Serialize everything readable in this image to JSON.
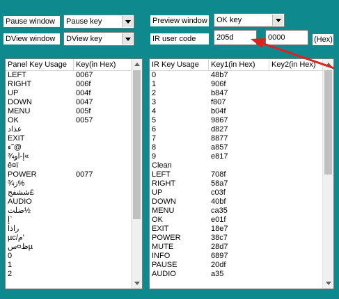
{
  "top": {
    "pause_window_label": "Pause window",
    "pause_key_value": "Pause key",
    "preview_window_label": "Preview window",
    "ok_key_value": "OK key",
    "dview_window_label": "DView window",
    "dview_key_value": "DView key",
    "ir_user_code_label": "IR user code",
    "ir_user_code_value": "205d",
    "second_code_value": "0000",
    "hex_label": "(Hex)"
  },
  "panel_table": {
    "headers": [
      "Panel Key Usage",
      "Key(in Hex)"
    ],
    "rows": [
      [
        "LEFT",
        "0067"
      ],
      [
        "RIGHT",
        "006f"
      ],
      [
        "UP",
        "004f"
      ],
      [
        "DOWN",
        "0047"
      ],
      [
        "MENU",
        "005f"
      ],
      [
        "OK",
        "0057"
      ],
      [
        "عذاد",
        ""
      ],
      [
        "EXIT",
        ""
      ],
      [
        "ء˜@",
        ""
      ],
      [
        "¾إ-أو«",
        ""
      ],
      [
        "ê¤ï",
        ""
      ],
      [
        "POWER",
        "0077"
      ],
      [
        "¾ز%",
        ""
      ],
      [
        "ششفج£",
        ""
      ],
      [
        "AUDIO",
        ""
      ],
      [
        "ضلت½",
        ""
      ],
      [
        "إ`",
        ""
      ],
      [
        "راذا",
        ""
      ],
      [
        "µc/م'",
        ""
      ],
      [
        "ظ¤سµ",
        ""
      ],
      [
        "0",
        ""
      ],
      [
        "1",
        ""
      ],
      [
        "2",
        ""
      ]
    ]
  },
  "ir_table": {
    "headers": [
      "IR Key Usage",
      "Key1(in Hex)",
      "Key2(in Hex)"
    ],
    "rows": [
      [
        "0",
        "48b7",
        ""
      ],
      [
        "1",
        "906f",
        ""
      ],
      [
        "2",
        "b847",
        ""
      ],
      [
        "3",
        "f807",
        ""
      ],
      [
        "4",
        "b04f",
        ""
      ],
      [
        "5",
        "9867",
        ""
      ],
      [
        "6",
        "d827",
        ""
      ],
      [
        "7",
        "8877",
        ""
      ],
      [
        "8",
        "a857",
        ""
      ],
      [
        "9",
        "e817",
        ""
      ],
      [
        "Clean",
        "",
        ""
      ],
      [
        "LEFT",
        "708f",
        ""
      ],
      [
        "RIGHT",
        "58a7",
        ""
      ],
      [
        "UP",
        "c03f",
        ""
      ],
      [
        "DOWN",
        "40bf",
        ""
      ],
      [
        "MENU",
        "ca35",
        ""
      ],
      [
        "OK",
        "e01f",
        ""
      ],
      [
        "EXIT",
        "18e7",
        ""
      ],
      [
        "POWER",
        "38c7",
        ""
      ],
      [
        "MUTE",
        "28d7",
        ""
      ],
      [
        "INFO",
        "6897",
        ""
      ],
      [
        "PAUSE",
        "20df",
        ""
      ],
      [
        "AUDIO",
        "a35",
        ""
      ]
    ]
  },
  "annotation": {
    "arrow_color": "#e0201c"
  }
}
